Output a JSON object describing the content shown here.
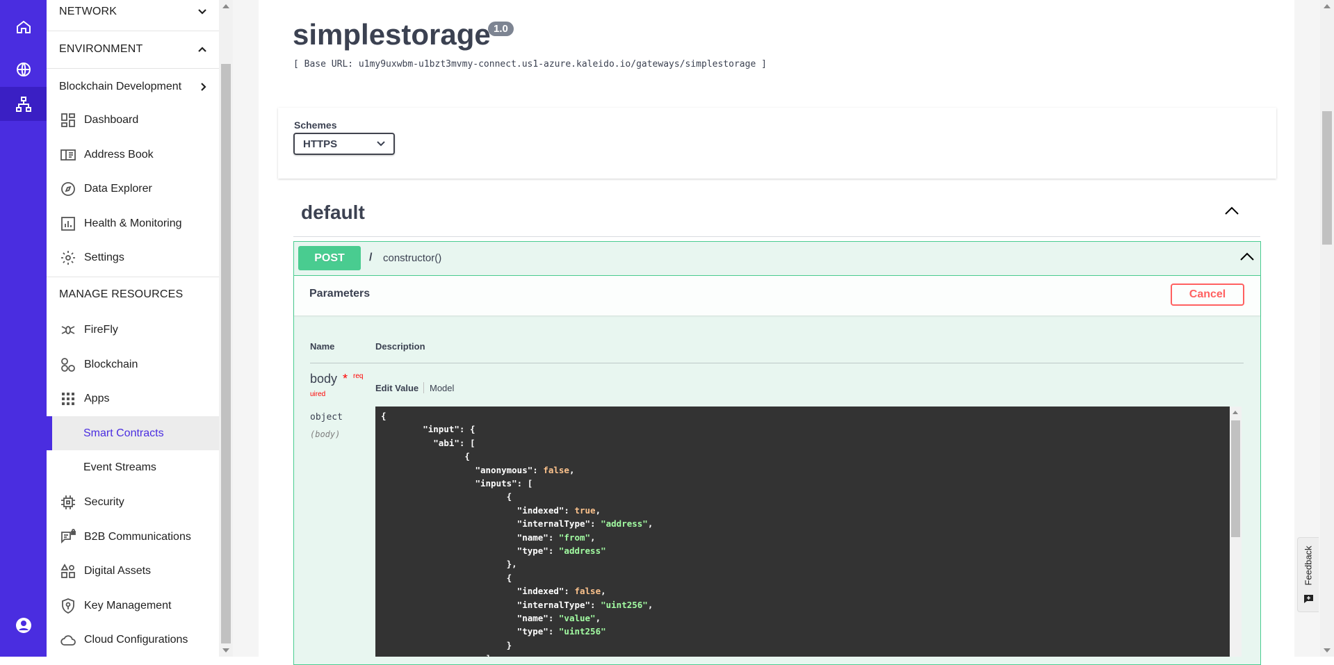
{
  "rail": {
    "items": [
      {
        "name": "home-icon"
      },
      {
        "name": "globe-icon"
      },
      {
        "name": "network-icon"
      },
      {
        "name": "account-icon"
      }
    ]
  },
  "sidenav": {
    "network_label": "NETWORK",
    "environment_label": "ENVIRONMENT",
    "environment_name": "Blockchain Development",
    "items": [
      {
        "label": "Dashboard",
        "icon": "dashboard-icon"
      },
      {
        "label": "Address Book",
        "icon": "address-book-icon"
      },
      {
        "label": "Data Explorer",
        "icon": "compass-icon"
      },
      {
        "label": "Health & Monitoring",
        "icon": "chart-icon"
      },
      {
        "label": "Settings",
        "icon": "gear-icon"
      }
    ],
    "manage_label": "MANAGE RESOURCES",
    "resources": [
      {
        "label": "FireFly",
        "icon": "firefly-icon"
      },
      {
        "label": "Blockchain",
        "icon": "blockchain-icon"
      },
      {
        "label": "Apps",
        "icon": "apps-grid-icon"
      },
      {
        "label": "Smart Contracts",
        "selected": true
      },
      {
        "label": "Event Streams"
      },
      {
        "label": "Security",
        "icon": "chip-icon"
      },
      {
        "label": "B2B Communications",
        "icon": "chat-lock-icon"
      },
      {
        "label": "Digital Assets",
        "icon": "shapes-icon"
      },
      {
        "label": "Key Management",
        "icon": "shield-key-icon"
      },
      {
        "label": "Cloud Configurations",
        "icon": "cloud-icon"
      }
    ]
  },
  "api": {
    "title": "simplestorage",
    "version": "1.0",
    "base_url": "[ Base URL: u1my9uxwbm-u1bzt3mvmy-connect.us1-azure.kaleido.io/gateways/simplestorage ]",
    "schemes_label": "Schemes",
    "scheme_value": "HTTPS",
    "scheme_options": [
      "HTTPS"
    ],
    "section_title": "default",
    "operation": {
      "method": "POST",
      "slash": "/",
      "path": "constructor()"
    },
    "parameters_title": "Parameters",
    "cancel_label": "Cancel",
    "col_name": "Name",
    "col_description": "Description",
    "param": {
      "name": "body",
      "star": "*",
      "required_part1": "req",
      "required_part2": "uired",
      "type": "object",
      "in": "(body)"
    },
    "tab_edit": "Edit Value",
    "tab_model": "Model",
    "code_lines": [
      {
        "indent": "",
        "parts": [
          {
            "t": "{",
            "c": "k"
          }
        ]
      },
      {
        "indent": "        ",
        "parts": [
          {
            "t": "\"input\": {",
            "c": "k"
          }
        ]
      },
      {
        "indent": "          ",
        "parts": [
          {
            "t": "\"abi\": [",
            "c": "k"
          }
        ]
      },
      {
        "indent": "                ",
        "parts": [
          {
            "t": "{",
            "c": "k"
          }
        ]
      },
      {
        "indent": "                  ",
        "parts": [
          {
            "t": "\"anonymous\": ",
            "c": "k"
          },
          {
            "t": "false",
            "c": "b"
          },
          {
            "t": ",",
            "c": "k"
          }
        ]
      },
      {
        "indent": "                  ",
        "parts": [
          {
            "t": "\"inputs\": [",
            "c": "k"
          }
        ]
      },
      {
        "indent": "                        ",
        "parts": [
          {
            "t": "{",
            "c": "k"
          }
        ]
      },
      {
        "indent": "                          ",
        "parts": [
          {
            "t": "\"indexed\": ",
            "c": "k"
          },
          {
            "t": "true",
            "c": "b"
          },
          {
            "t": ",",
            "c": "k"
          }
        ]
      },
      {
        "indent": "                          ",
        "parts": [
          {
            "t": "\"internalType\": ",
            "c": "k"
          },
          {
            "t": "\"address\"",
            "c": "s"
          },
          {
            "t": ",",
            "c": "k"
          }
        ]
      },
      {
        "indent": "                          ",
        "parts": [
          {
            "t": "\"name\": ",
            "c": "k"
          },
          {
            "t": "\"from\"",
            "c": "s"
          },
          {
            "t": ",",
            "c": "k"
          }
        ]
      },
      {
        "indent": "                          ",
        "parts": [
          {
            "t": "\"type\": ",
            "c": "k"
          },
          {
            "t": "\"address\"",
            "c": "s"
          }
        ]
      },
      {
        "indent": "                        ",
        "parts": [
          {
            "t": "},",
            "c": "k"
          }
        ]
      },
      {
        "indent": "                        ",
        "parts": [
          {
            "t": "{",
            "c": "k"
          }
        ]
      },
      {
        "indent": "                          ",
        "parts": [
          {
            "t": "\"indexed\": ",
            "c": "k"
          },
          {
            "t": "false",
            "c": "b"
          },
          {
            "t": ",",
            "c": "k"
          }
        ]
      },
      {
        "indent": "                          ",
        "parts": [
          {
            "t": "\"internalType\": ",
            "c": "k"
          },
          {
            "t": "\"uint256\"",
            "c": "s"
          },
          {
            "t": ",",
            "c": "k"
          }
        ]
      },
      {
        "indent": "                          ",
        "parts": [
          {
            "t": "\"name\": ",
            "c": "k"
          },
          {
            "t": "\"value\"",
            "c": "s"
          },
          {
            "t": ",",
            "c": "k"
          }
        ]
      },
      {
        "indent": "                          ",
        "parts": [
          {
            "t": "\"type\": ",
            "c": "k"
          },
          {
            "t": "\"uint256\"",
            "c": "s"
          }
        ]
      },
      {
        "indent": "                        ",
        "parts": [
          {
            "t": "}",
            "c": "k"
          }
        ]
      },
      {
        "indent": "                    ",
        "parts": [
          {
            "t": "],",
            "c": "k"
          }
        ]
      }
    ]
  },
  "feedback_label": "Feedback",
  "colors": {
    "brand": "#4a2de0",
    "post_green": "#49cc90",
    "cancel_red": "#ff6060"
  }
}
